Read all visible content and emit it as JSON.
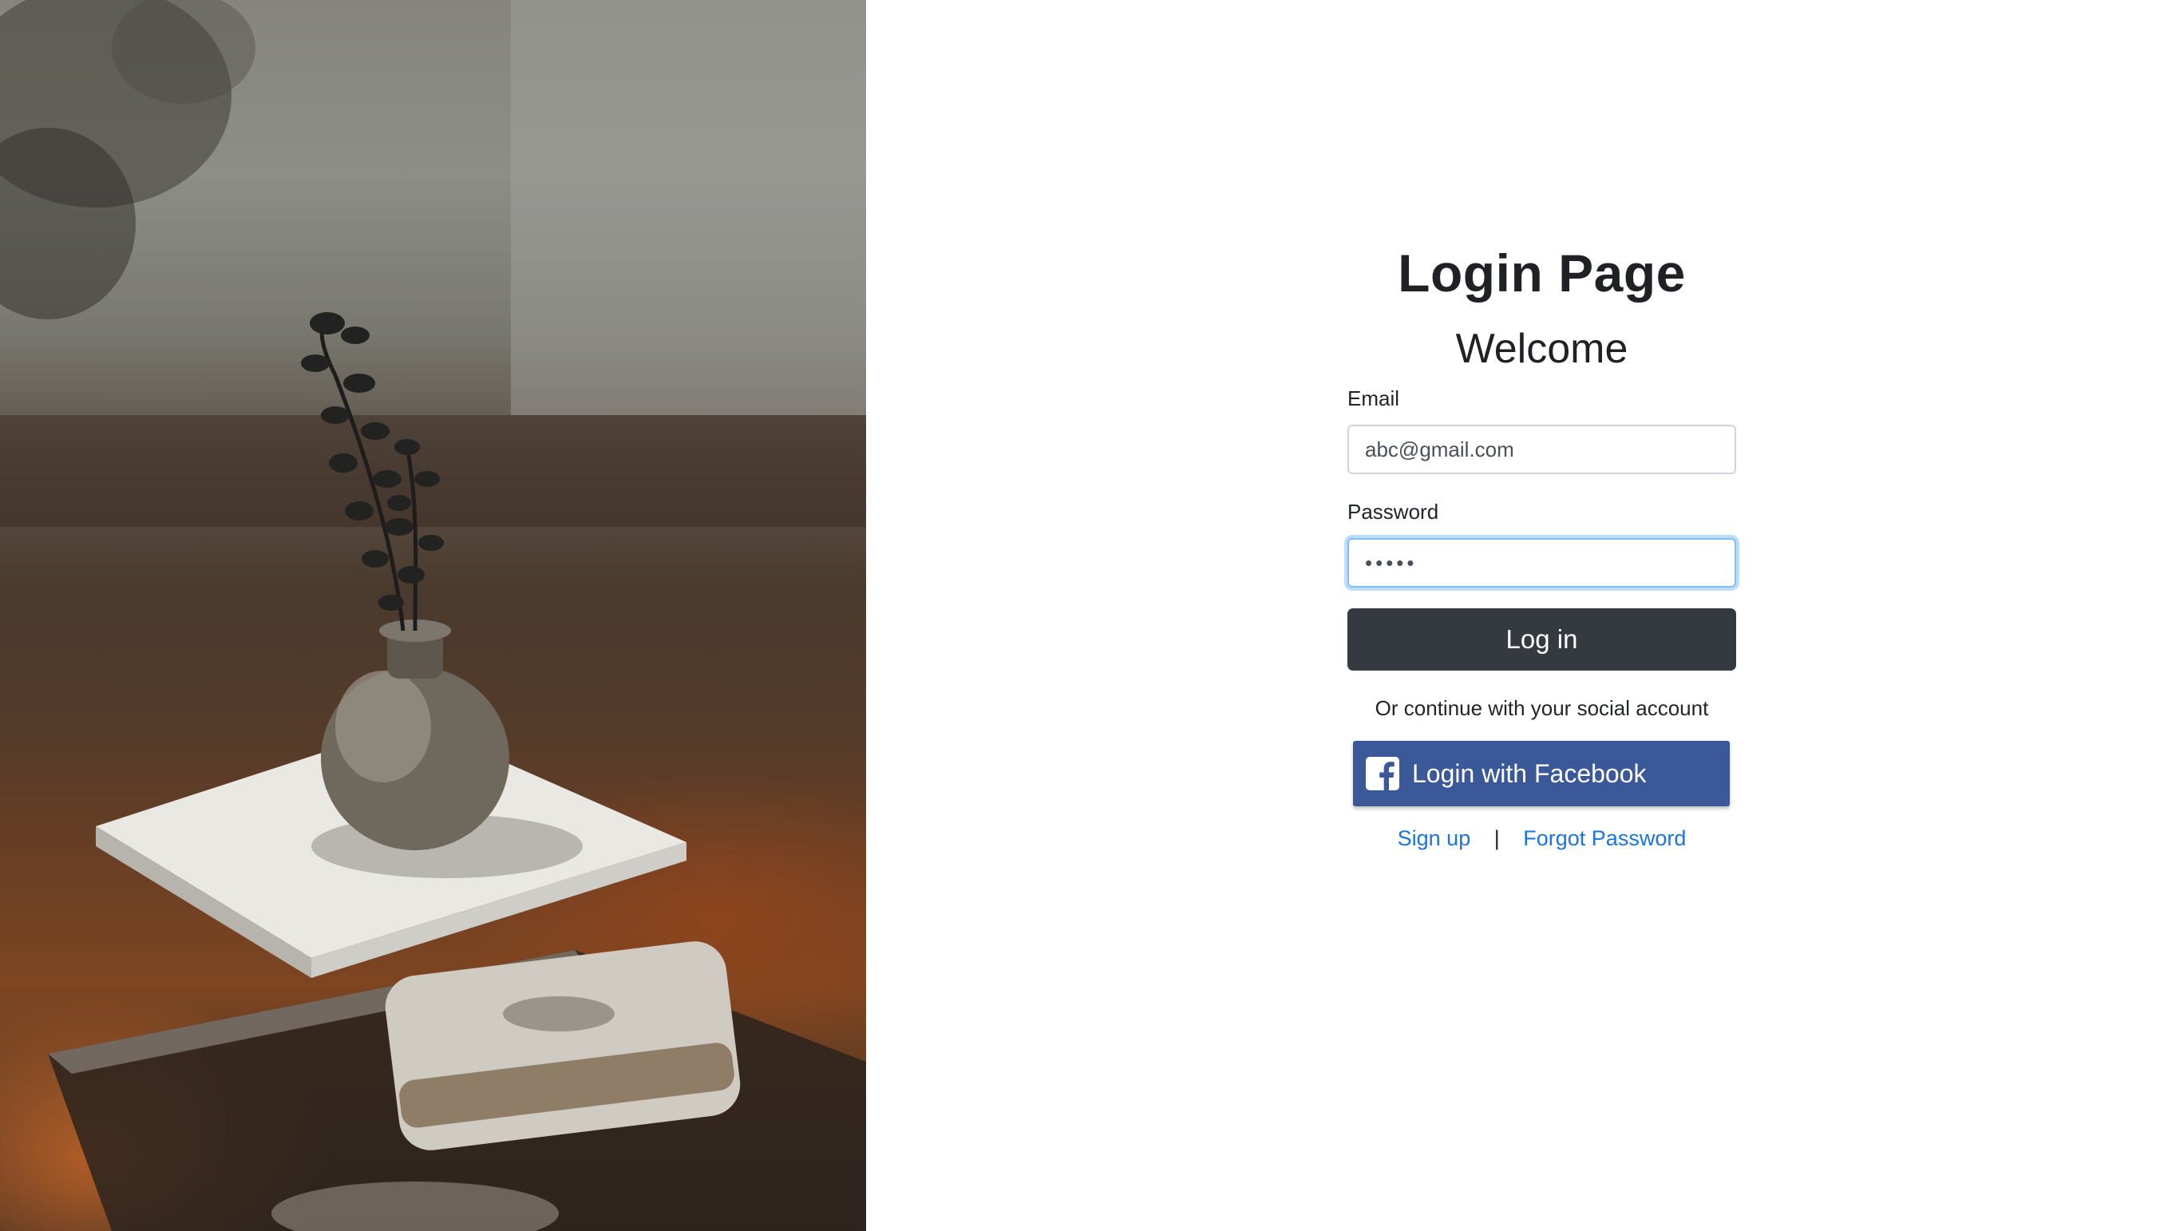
{
  "login": {
    "title": "Login Page",
    "welcome": "Welcome",
    "email_label": "Email",
    "email_value": "abc@gmail.com",
    "password_label": "Password",
    "password_value": "•••••",
    "login_button": "Log in",
    "social_text": "Or continue with your social account",
    "facebook_button": "Login with Facebook",
    "signup_link": "Sign up",
    "separator": "|",
    "forgot_link": "Forgot Password"
  },
  "colors": {
    "login_button_bg": "#343a40",
    "facebook_bg": "#3b5998",
    "link": "#1a73e8",
    "focus_border": "#80bdff"
  },
  "icons": {
    "facebook": "facebook-logo-icon"
  },
  "image": {
    "description_name": "vase-with-eucalyptus-on-book-photo"
  }
}
